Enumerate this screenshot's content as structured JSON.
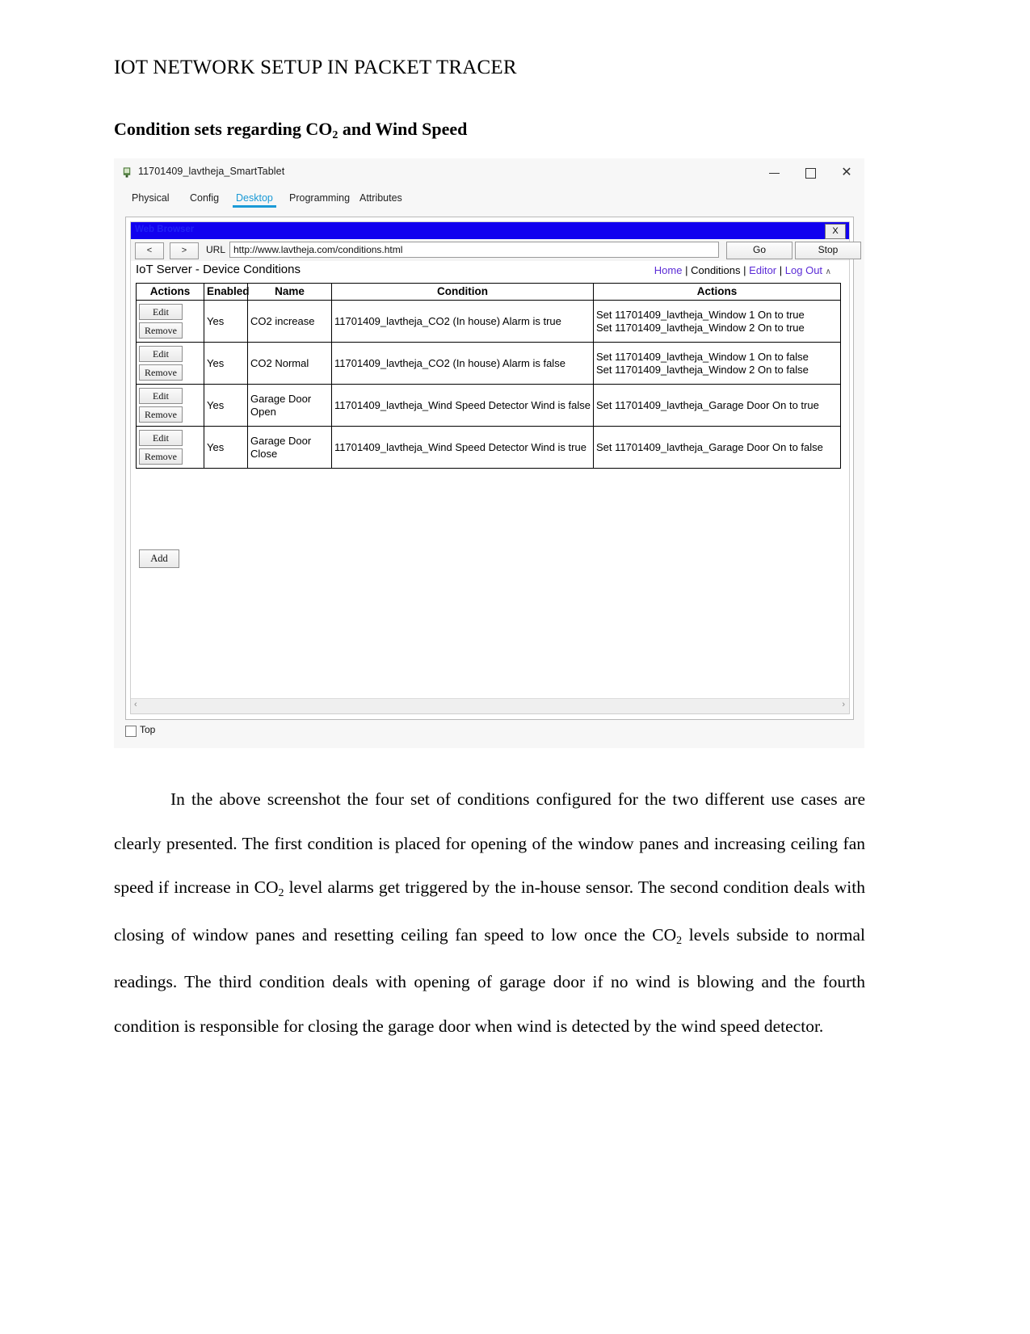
{
  "document": {
    "title": "IOT NETWORK SETUP IN PACKET TRACER",
    "section_heading_before": "Condition sets regarding CO",
    "section_heading_sub": "2",
    "section_heading_after": " and Wind Speed",
    "paragraph_part1": "In the above screenshot the four set of conditions configured for the two different use cases are clearly presented. The first condition is placed for opening of the window panes and increasing ceiling fan speed if increase in CO",
    "paragraph_sub1": "2",
    "paragraph_part2": " level alarms get triggered by the in-house sensor. The second condition deals with closing of window panes and resetting ceiling fan speed to low once the CO",
    "paragraph_sub2": "2",
    "paragraph_part3": " levels subside to normal readings. The third condition deals with opening of garage door if no wind is blowing and the fourth condition is responsible for closing the garage door when wind is detected by the wind speed detector."
  },
  "window": {
    "title": "11701409_lavtheja_SmartTablet",
    "minimize": "–",
    "maximize": "□",
    "close": "✕"
  },
  "device_tabs": [
    {
      "label": "Physical",
      "active": false
    },
    {
      "label": "Config",
      "active": false
    },
    {
      "label": "Desktop",
      "active": true
    },
    {
      "label": "Programming",
      "active": false
    },
    {
      "label": "Attributes",
      "active": false
    }
  ],
  "browser": {
    "title": "Web Browser",
    "close_label": "X",
    "back_label": "<",
    "forward_label": ">",
    "url_label": "URL",
    "url_value": "http://www.lavtheja.com/conditions.html",
    "go_label": "Go",
    "stop_label": "Stop"
  },
  "server_page": {
    "heading": "IoT Server - Device Conditions",
    "links": [
      {
        "label": "Home",
        "current": false
      },
      {
        "label": "Conditions",
        "current": true
      },
      {
        "label": "Editor",
        "current": false
      },
      {
        "label": "Log Out",
        "current": false
      }
    ],
    "link_separator": "|",
    "caret": "∧",
    "table": {
      "headers": [
        "Actions",
        "Enabled",
        "Name",
        "Condition",
        "Actions"
      ],
      "edit_label": "Edit",
      "remove_label": "Remove",
      "rows": [
        {
          "enabled": "Yes",
          "name": "CO2 increase",
          "condition": "11701409_lavtheja_CO2 (In house) Alarm is true",
          "actions": "Set 11701409_lavtheja_Window 1 On to true\nSet 11701409_lavtheja_Window 2 On to true"
        },
        {
          "enabled": "Yes",
          "name": "CO2 Normal",
          "condition": "11701409_lavtheja_CO2 (In house) Alarm is false",
          "actions": "Set 11701409_lavtheja_Window 1 On to false\nSet 11701409_lavtheja_Window 2 On to false"
        },
        {
          "enabled": "Yes",
          "name": "Garage Door Open",
          "condition": "11701409_lavtheja_Wind Speed Detector Wind is false",
          "actions": "Set 11701409_lavtheja_Garage Door On to true"
        },
        {
          "enabled": "Yes",
          "name": "Garage Door Close",
          "condition": "11701409_lavtheja_Wind Speed Detector Wind is true",
          "actions": "Set 11701409_lavtheja_Garage Door On to false"
        }
      ],
      "add_label": "Add"
    },
    "scroll_left": "‹",
    "scroll_right": "›",
    "scroll_down": "∨"
  },
  "footer": {
    "top_label": "Top"
  },
  "colors": {
    "tab_active": "#1a9ad6",
    "browser_titlebar": "#1100ef",
    "link": "#5b2bd6"
  }
}
